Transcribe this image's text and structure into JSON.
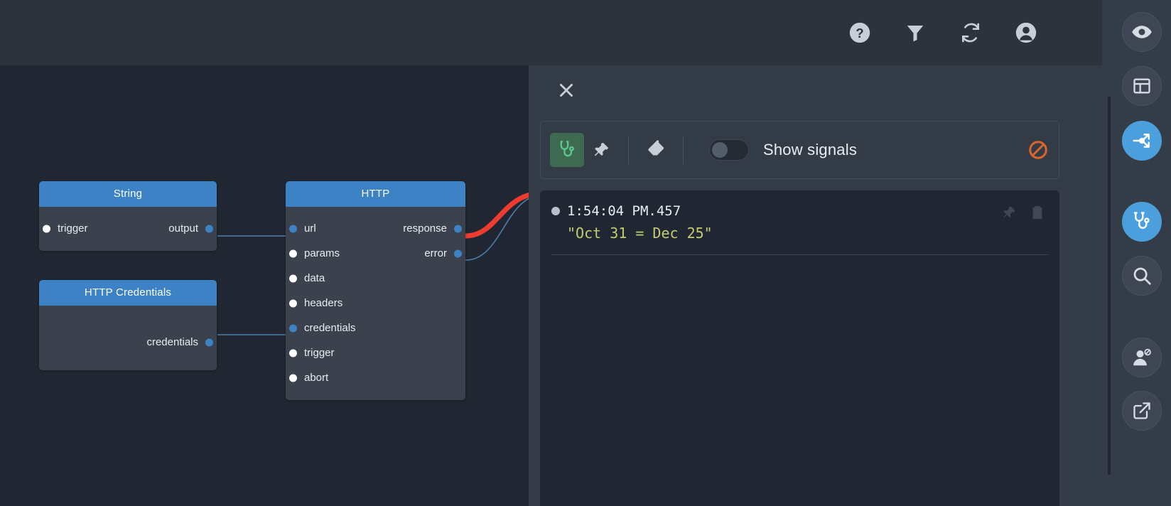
{
  "header": {
    "icons": [
      {
        "name": "help-icon",
        "label": "Help"
      },
      {
        "name": "filter-icon",
        "label": "Filter"
      },
      {
        "name": "refresh-icon",
        "label": "Refresh"
      },
      {
        "name": "account-icon",
        "label": "Account"
      }
    ]
  },
  "canvas": {
    "nodes": [
      {
        "title": "String",
        "inputs": [
          {
            "label": "trigger",
            "state": "white"
          }
        ],
        "outputs": [
          {
            "label": "output",
            "state": "blue"
          }
        ]
      },
      {
        "title": "HTTP",
        "inputs": [
          {
            "label": "url",
            "state": "blue"
          },
          {
            "label": "params",
            "state": "white"
          },
          {
            "label": "data",
            "state": "white"
          },
          {
            "label": "headers",
            "state": "white"
          },
          {
            "label": "credentials",
            "state": "blue"
          },
          {
            "label": "trigger",
            "state": "white"
          },
          {
            "label": "abort",
            "state": "white"
          }
        ],
        "outputs": [
          {
            "label": "response",
            "state": "blue"
          },
          {
            "label": "error",
            "state": "blue"
          }
        ]
      },
      {
        "title": "HTTP Credentials",
        "inputs": [],
        "outputs": [
          {
            "label": "credentials",
            "state": "blue"
          }
        ]
      }
    ],
    "wire_colors": {
      "normal": "#4b7ea8",
      "highlight": "#ef3b30"
    }
  },
  "panel": {
    "close_label": "Close",
    "toolbar": {
      "inspect_label": "Inspect",
      "pin_label": "Pin",
      "clear_label": "Clear",
      "toggle_state": "off",
      "toggle_label": "Show signals",
      "block_label": "Block"
    },
    "log": {
      "entries": [
        {
          "time": "1:54:04 PM.457",
          "value": "\"Oct 31 = Dec 25\"",
          "pin_label": "Pin entry",
          "copy_label": "Copy entry"
        }
      ]
    }
  },
  "rail": {
    "items": [
      {
        "name": "eye-icon",
        "label": "Preview",
        "active": false
      },
      {
        "name": "layout-icon",
        "label": "Layout",
        "active": false
      },
      {
        "name": "share-nodes-icon",
        "label": "Nodes",
        "active": true
      },
      {
        "name": "stethoscope-icon",
        "label": "Inspect",
        "active": true
      },
      {
        "name": "search-icon",
        "label": "Search",
        "active": false
      },
      {
        "name": "user-blocked-icon",
        "label": "Permissions",
        "active": false
      },
      {
        "name": "external-link-icon",
        "label": "Open external",
        "active": false
      }
    ]
  },
  "colors": {
    "canvas_bg": "#212732",
    "panel_bg": "#333b47",
    "node_header": "#3d82c4",
    "node_body": "#3b424e",
    "accent_blue": "#4a9fdc",
    "accent_green": "#5bc98a",
    "accent_orange": "#d9662a",
    "wire_red": "#ef3b30",
    "log_value": "#c3cc70"
  }
}
